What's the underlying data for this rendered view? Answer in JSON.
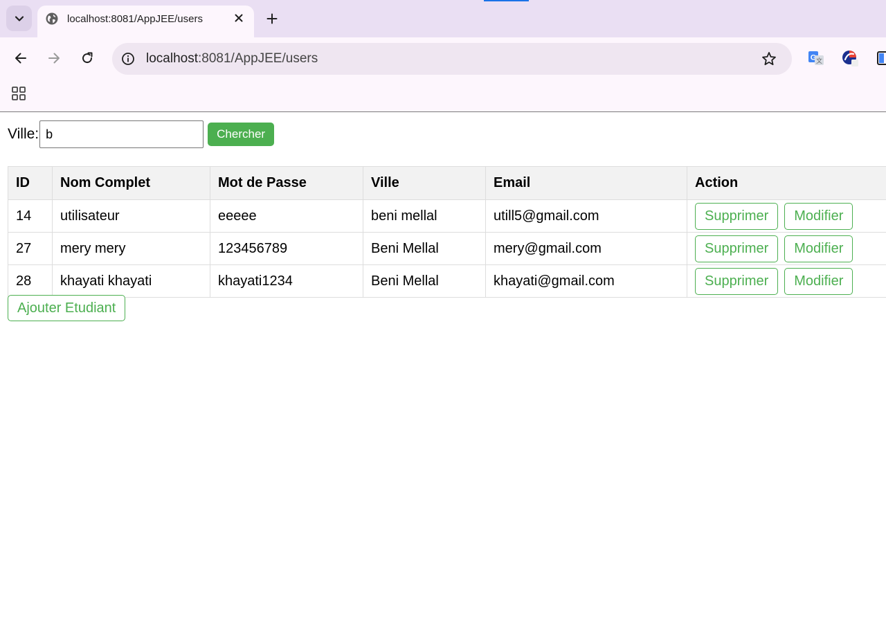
{
  "browser": {
    "tab_title": "localhost:8081/AppJEE/users",
    "url_host": "localhost",
    "url_path": ":8081/AppJEE/users",
    "accent_color": "#1a73e8"
  },
  "search": {
    "label": "Ville:",
    "value": "b",
    "button_label": "Chercher",
    "button_color": "#4caf50"
  },
  "table": {
    "headers": [
      "ID",
      "Nom Complet",
      "Mot de Passe",
      "Ville",
      "Email",
      "Action"
    ],
    "rows": [
      {
        "id": "14",
        "nom": "utilisateur",
        "mdp": "eeeee",
        "ville": "beni mellal",
        "email": "utill5@gmail.com"
      },
      {
        "id": "27",
        "nom": "mery mery",
        "mdp": "123456789",
        "ville": "Beni Mellal",
        "email": "mery@gmail.com"
      },
      {
        "id": "28",
        "nom": "khayati khayati",
        "mdp": "khayati1234",
        "ville": "Beni Mellal",
        "email": "khayati@gmail.com"
      }
    ],
    "delete_label": "Supprimer",
    "edit_label": "Modifier"
  },
  "add_button_label": "Ajouter Etudiant",
  "icons": {
    "tab_search": "chevron-down-icon",
    "favicon": "globe-icon",
    "close": "close-icon",
    "new_tab": "plus-icon",
    "back": "back-arrow-icon",
    "forward": "forward-arrow-icon",
    "reload": "reload-icon",
    "site_info": "info-icon",
    "bookmark": "star-icon",
    "translate": "translate-icon",
    "extension": "extension-icon",
    "sidepanel": "side-panel-icon",
    "apps": "apps-grid-icon"
  }
}
